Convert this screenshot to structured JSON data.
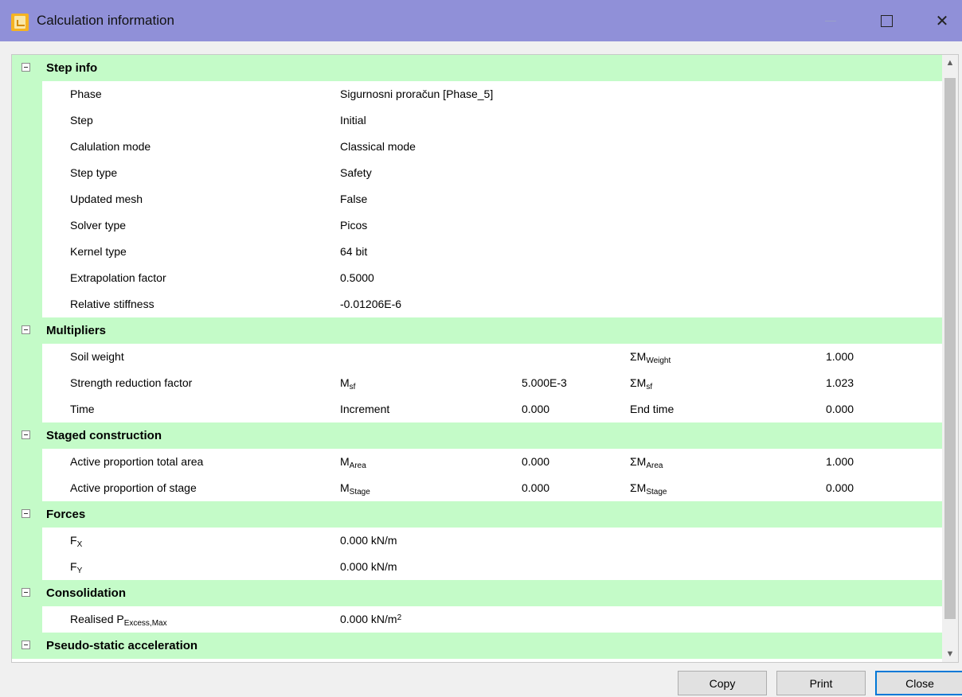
{
  "window": {
    "title": "Calculation information"
  },
  "sections": [
    {
      "title": "Step info",
      "rows": [
        {
          "label": "Phase",
          "value": "Sigurnosni proračun [Phase_5]"
        },
        {
          "label": "Step",
          "value": "Initial"
        },
        {
          "label": "Calulation mode",
          "value": "Classical mode"
        },
        {
          "label": "Step type",
          "value": "Safety"
        },
        {
          "label": "Updated mesh",
          "value": "False"
        },
        {
          "label": "Solver type",
          "value": "Picos"
        },
        {
          "label": "Kernel type",
          "value": "64 bit"
        },
        {
          "label": "Extrapolation factor",
          "value": "0.5000"
        },
        {
          "label": "Relative stiffness",
          "value": "-0.01206E-6"
        }
      ]
    },
    {
      "title": "Multipliers",
      "rows": [
        {
          "label": "Soil weight",
          "m": "",
          "m_sub": "",
          "m_val": "",
          "sum": "ΣM",
          "sum_sub": "Weight",
          "sum_val": "1.000"
        },
        {
          "label": "Strength reduction factor",
          "m": "M",
          "m_sub": "sf",
          "m_val": "5.000E-3",
          "sum": "ΣM",
          "sum_sub": "sf",
          "sum_val": "1.023"
        },
        {
          "label": "Time",
          "m": "Increment",
          "m_sub": "",
          "m_val": "0.000",
          "sum": "End time",
          "sum_sub": "",
          "sum_val": "0.000"
        }
      ]
    },
    {
      "title": "Staged construction",
      "rows": [
        {
          "label": "Active proportion total area",
          "m": "M",
          "m_sub": "Area",
          "m_val": "0.000",
          "sum": "ΣM",
          "sum_sub": "Area",
          "sum_val": "1.000"
        },
        {
          "label": "Active proportion of stage",
          "m": "M",
          "m_sub": "Stage",
          "m_val": "0.000",
          "sum": "ΣM",
          "sum_sub": "Stage",
          "sum_val": "0.000"
        }
      ]
    },
    {
      "title": "Forces",
      "rows": [
        {
          "label": "F",
          "label_sub": "X",
          "value": "0.000 kN/m"
        },
        {
          "label": "F",
          "label_sub": "Y",
          "value": "0.000 kN/m"
        }
      ]
    },
    {
      "title": "Consolidation",
      "rows": [
        {
          "label": "Realised P",
          "label_sub": "Excess,Max",
          "value": "0.000 kN/m",
          "value_sup": "2"
        }
      ]
    },
    {
      "title": "Pseudo-static acceleration",
      "rows": []
    }
  ],
  "buttons": {
    "copy": "Copy",
    "print": "Print",
    "close": "Close"
  }
}
